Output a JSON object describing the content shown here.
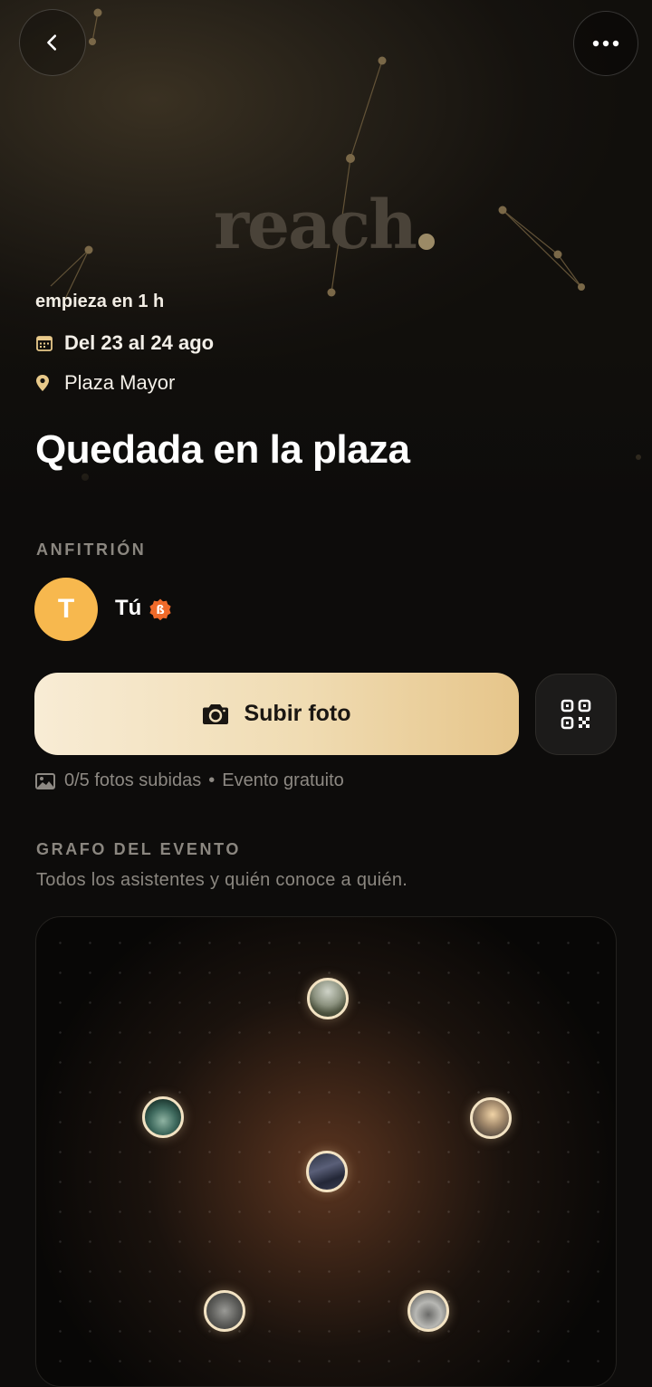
{
  "header": {
    "brand": "reach",
    "back_icon": "chevron-left-icon",
    "more_icon": "more-horizontal-icon"
  },
  "event": {
    "starts_in": "empieza en 1 h",
    "date_range": "Del 23 al 24 ago",
    "location": "Plaza Mayor",
    "title": "Quedada en la plaza"
  },
  "host": {
    "section_label": "ANFITRIÓN",
    "avatar_initial": "T",
    "avatar_color": "#f7b84e",
    "name": "Tú"
  },
  "actions": {
    "upload_label": "Subir foto",
    "upload_icon": "camera-icon",
    "qr_icon": "qr-code-icon"
  },
  "photos": {
    "uploaded": "0/5 fotos subidas",
    "separator": "•",
    "price": "Evento gratuito"
  },
  "graph": {
    "section_label": "GRAFO DEL EVENTO",
    "subtitle": "Todos los asistentes y quién conoce a quién."
  },
  "colors": {
    "accent_gold": "#e6c58a",
    "background": "#0d0c0b",
    "badge_orange": "#f06a2a"
  }
}
